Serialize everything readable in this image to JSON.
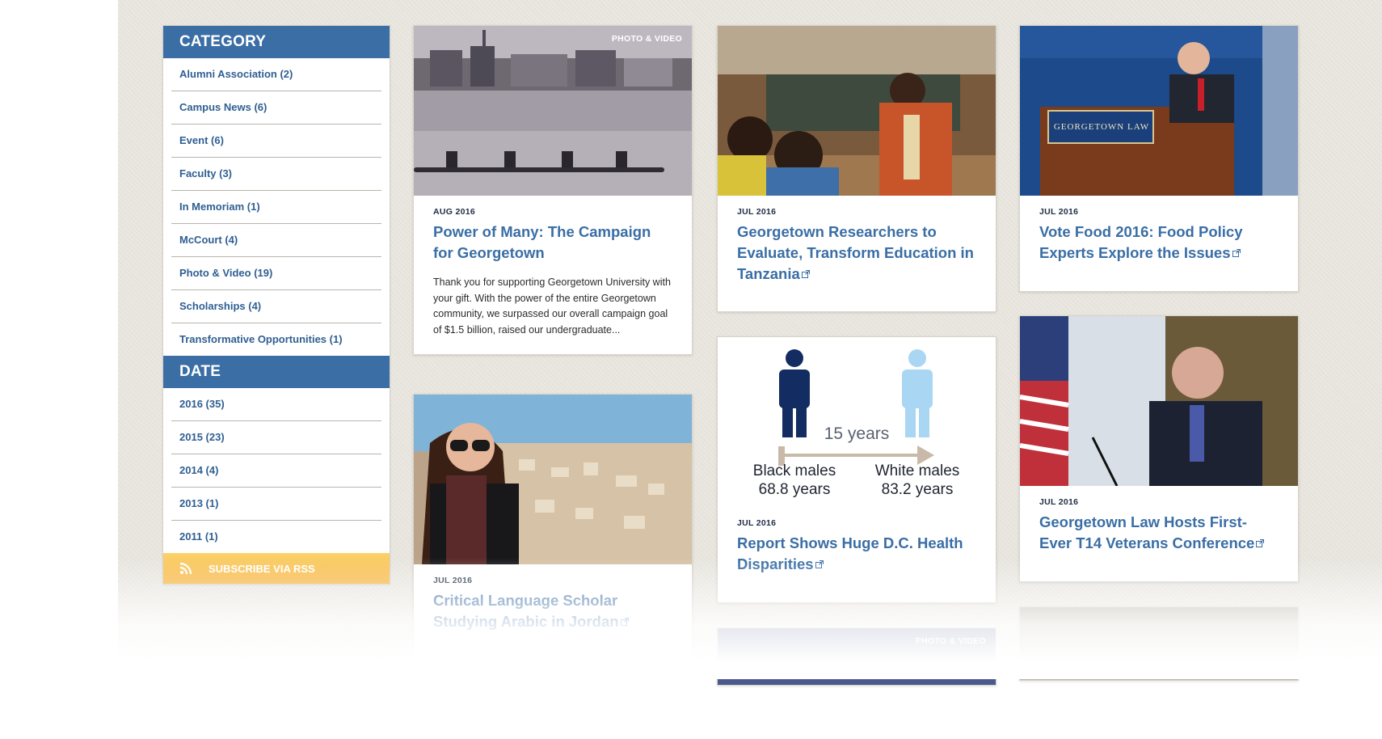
{
  "sidebar": {
    "category_title": "CATEGORY",
    "categories": [
      "Alumni Association (2)",
      "Campus News (6)",
      "Event (6)",
      "Faculty (3)",
      "In Memoriam (1)",
      "McCourt (4)",
      "Photo & Video (19)",
      "Scholarships (4)",
      "Transformative Opportunities (1)"
    ],
    "date_title": "DATE",
    "dates": [
      "2016 (35)",
      "2015 (23)",
      "2014 (4)",
      "2013 (1)",
      "2011 (1)"
    ],
    "rss_label": "SUBSCRIBE VIA RSS"
  },
  "cards": {
    "campaign": {
      "badge": "PHOTO & VIDEO",
      "date": "AUG 2016",
      "title": "Power of Many: The Campaign for Georgetown",
      "description": "Thank you for supporting Georgetown University with your gift. With the power of the entire Georgetown community, we surpassed our overall campaign goal of $1.5 billion, raised our undergraduate..."
    },
    "tanzania": {
      "date": "JUL 2016",
      "title": "Georgetown Researchers to Evaluate, Transform Education in Tanzania"
    },
    "votefood": {
      "date": "JUL 2016",
      "title": "Vote Food 2016: Food Policy Experts Explore the Issues",
      "podium_sign": "GEORGETOWN LAW"
    },
    "health": {
      "date": "JUL 2016",
      "title": "Report Shows Huge D.C. Health Disparities",
      "infographic": {
        "gap_label": "15 years",
        "left_label": "Black males",
        "left_value": "68.8 years",
        "right_label": "White males",
        "right_value": "83.2 years"
      }
    },
    "arabic": {
      "date": "JUL 2016",
      "title": "Critical Language Scholar Studying Arabic in Jordan"
    },
    "veterans": {
      "date": "JUL 2016",
      "title": "Georgetown Law Hosts First-Ever T14 Veterans Conference"
    },
    "partial": {
      "badge": "PHOTO & VIDEO"
    }
  },
  "colors": {
    "accent": "#3a6ea5",
    "rss": "#f6b33c",
    "background": "#e9e6df"
  }
}
